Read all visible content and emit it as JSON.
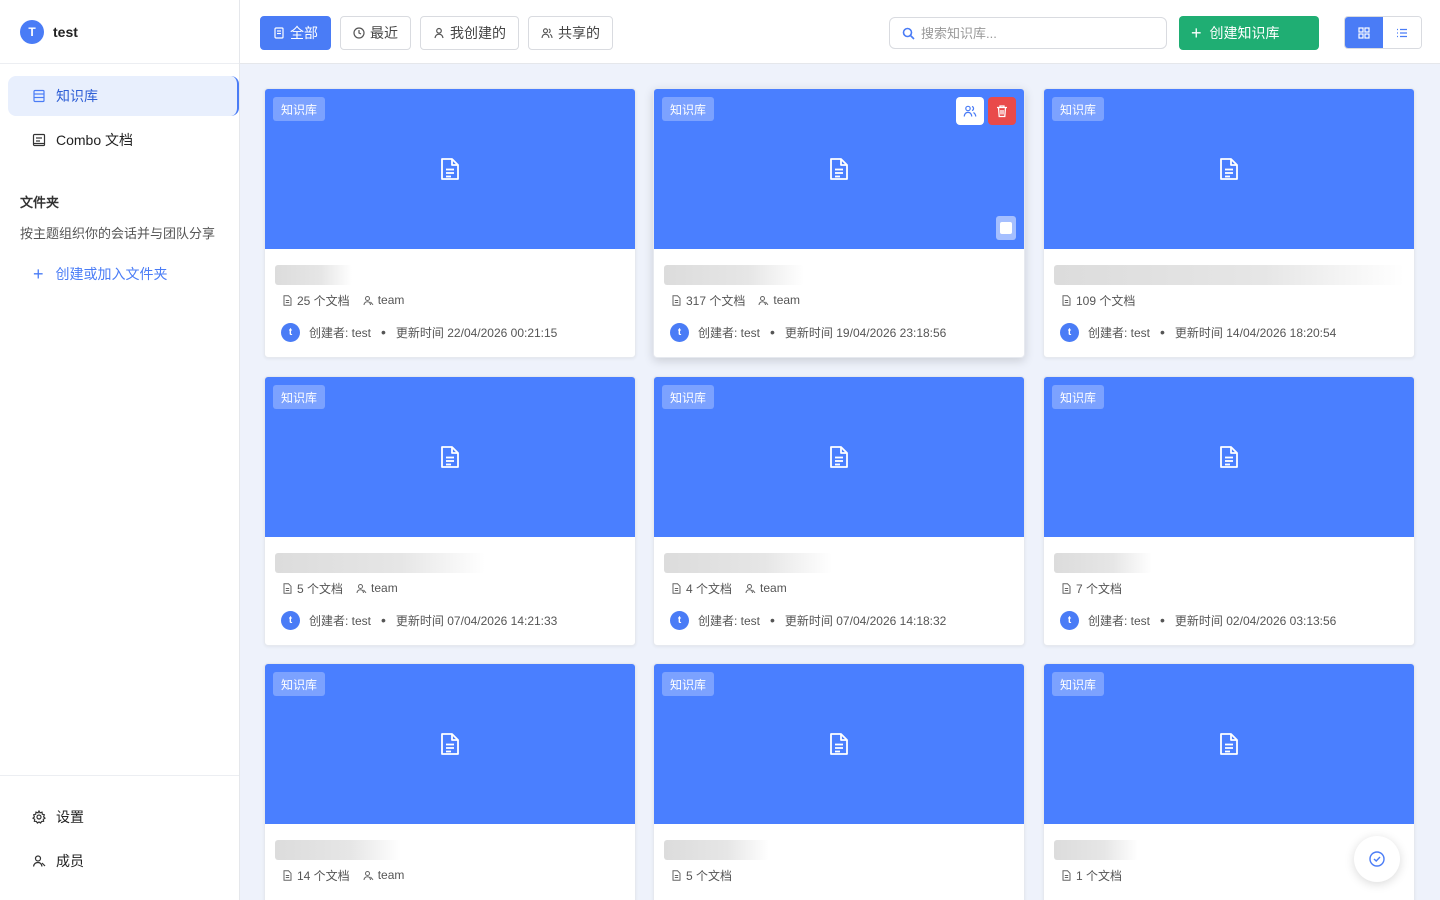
{
  "brand": {
    "avatar_letter": "T",
    "name": "test"
  },
  "sidebar": {
    "items": [
      {
        "label": "知识库",
        "icon": "database-icon",
        "active": true
      },
      {
        "label": "Combo 文档",
        "icon": "combo-doc-icon",
        "active": false
      }
    ],
    "folder_title": "文件夹",
    "folder_desc": "按主题组织你的会话并与团队分享",
    "folder_add_label": "创建或加入文件夹",
    "bottom": [
      {
        "label": "设置",
        "icon": "gear-icon"
      },
      {
        "label": "成员",
        "icon": "members-icon"
      }
    ]
  },
  "toolbar": {
    "filters": [
      {
        "label": "全部",
        "icon": "doc-icon",
        "active": true
      },
      {
        "label": "最近",
        "icon": "clock-icon",
        "active": false
      },
      {
        "label": "我创建的",
        "icon": "user-icon",
        "active": false
      },
      {
        "label": "共享的",
        "icon": "users-icon",
        "active": false
      }
    ],
    "search_placeholder": "搜索知识库...",
    "create_label": "创建知识库",
    "view_modes": [
      "grid-view-icon",
      "list-view-icon"
    ],
    "active_view": "grid"
  },
  "cards": [
    {
      "tag": "知识库",
      "doc_count": "25 个文档",
      "team": "team",
      "creator": "创建者: test",
      "updated": "更新时间 22/04/2026 00:21:15",
      "author_letter": "t"
    },
    {
      "tag": "知识库",
      "doc_count": "317 个文档",
      "team": "team",
      "creator": "创建者: test",
      "updated": "更新时间 19/04/2026 23:18:56",
      "author_letter": "t",
      "hover": true
    },
    {
      "tag": "知识库",
      "doc_count": "109 个文档",
      "team": "",
      "creator": "创建者: test",
      "updated": "更新时间 14/04/2026 18:20:54",
      "author_letter": "t"
    },
    {
      "tag": "知识库",
      "doc_count": "5 个文档",
      "team": "team",
      "creator": "创建者: test",
      "updated": "更新时间 07/04/2026 14:21:33",
      "author_letter": "t"
    },
    {
      "tag": "知识库",
      "doc_count": "4 个文档",
      "team": "team",
      "creator": "创建者: test",
      "updated": "更新时间 07/04/2026 14:18:32",
      "author_letter": "t"
    },
    {
      "tag": "知识库",
      "doc_count": "7 个文档",
      "team": "",
      "creator": "创建者: test",
      "updated": "更新时间 02/04/2026 03:13:56",
      "author_letter": "t"
    },
    {
      "tag": "知识库",
      "doc_count": "14 个文档",
      "team": "team",
      "creator": "",
      "updated": "",
      "author_letter": ""
    },
    {
      "tag": "知识库",
      "doc_count": "5 个文档",
      "team": "",
      "creator": "",
      "updated": "",
      "author_letter": ""
    },
    {
      "tag": "知识库",
      "doc_count": "1 个文档",
      "team": "",
      "creator": "",
      "updated": "",
      "author_letter": ""
    }
  ],
  "colors": {
    "accent": "#4a7cf6",
    "card_cover": "#4a7fff",
    "create": "#1fae73",
    "danger": "#e94a4a"
  }
}
